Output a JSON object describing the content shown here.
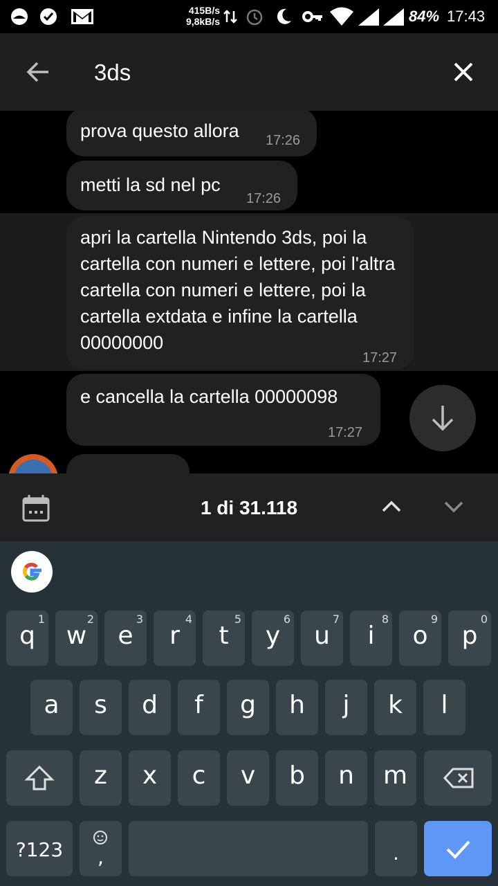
{
  "status_bar": {
    "speed_up": "415B/s",
    "speed_down": "9,8kB/s",
    "battery": "84%",
    "time": "17:43"
  },
  "search": {
    "query": "3ds",
    "back_icon": "arrow-left-icon",
    "close_icon": "close-icon"
  },
  "messages": [
    {
      "text": "prova questo allora",
      "time": "17:26"
    },
    {
      "text": "metti la sd nel pc",
      "time": "17:26"
    },
    {
      "text": "apri la cartella Nintendo 3ds, poi la cartella con numeri e lettere, poi l'altra cartella con numeri e lettere, poi la cartella extdata e infine la cartella 00000000",
      "time": "17:27"
    },
    {
      "text": "e cancella la cartella 00000098",
      "time": "17:27"
    }
  ],
  "search_nav": {
    "result_count": "1 di 31.118"
  },
  "keyboard": {
    "row1": [
      {
        "letter": "q",
        "num": "1"
      },
      {
        "letter": "w",
        "num": "2"
      },
      {
        "letter": "e",
        "num": "3"
      },
      {
        "letter": "r",
        "num": "4"
      },
      {
        "letter": "t",
        "num": "5"
      },
      {
        "letter": "y",
        "num": "6"
      },
      {
        "letter": "u",
        "num": "7"
      },
      {
        "letter": "i",
        "num": "8"
      },
      {
        "letter": "o",
        "num": "9"
      },
      {
        "letter": "p",
        "num": "0"
      }
    ],
    "row2": [
      "a",
      "s",
      "d",
      "f",
      "g",
      "h",
      "j",
      "k",
      "l"
    ],
    "row3": [
      "z",
      "x",
      "c",
      "v",
      "b",
      "n",
      "m"
    ],
    "symbols_label": "?123",
    "comma": ",",
    "period": "."
  },
  "colors": {
    "accent": "#5e97f6",
    "keyboard_bg": "#263238",
    "key_bg": "#3b464c",
    "bubble_bg": "#212121",
    "header_bg": "#1f1f1f"
  }
}
